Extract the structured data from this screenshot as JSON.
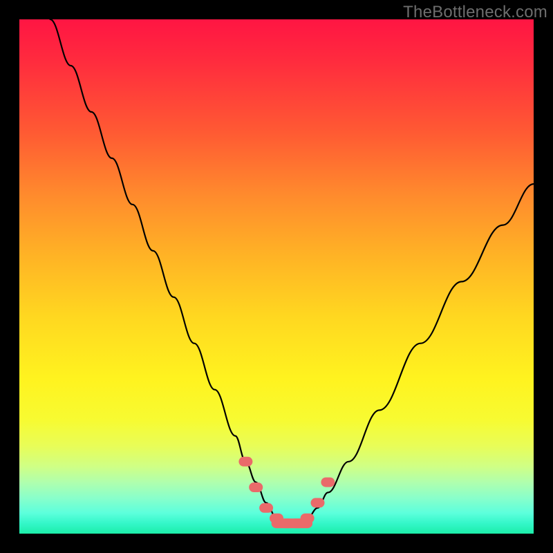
{
  "watermark": {
    "text": "TheBottleneck.com"
  },
  "chart_data": {
    "type": "line",
    "title": "",
    "xlabel": "",
    "ylabel": "",
    "xlim": [
      0,
      100
    ],
    "ylim": [
      0,
      100
    ],
    "grid": false,
    "legend": false,
    "background_gradient_meaning": "red=high bottleneck, green=low bottleneck",
    "series": [
      {
        "name": "bottleneck-curve",
        "color": "#000000",
        "x": [
          6,
          10,
          14,
          18,
          22,
          26,
          30,
          34,
          38,
          42,
          44,
          46,
          48,
          50,
          52,
          54,
          56,
          58,
          60,
          64,
          70,
          78,
          86,
          94,
          100
        ],
        "y": [
          100,
          91,
          82,
          73,
          64,
          55,
          46,
          37,
          28,
          19,
          14,
          10,
          6,
          3,
          2,
          2,
          3,
          5,
          8,
          14,
          24,
          37,
          49,
          60,
          68
        ]
      }
    ],
    "markers": {
      "name": "highlighted-points",
      "color": "#ea6a6a",
      "shape": "rounded-capsule",
      "points": [
        {
          "x": 44,
          "y": 14
        },
        {
          "x": 46,
          "y": 9
        },
        {
          "x": 48,
          "y": 5
        },
        {
          "x": 50,
          "y": 3
        },
        {
          "x": 52,
          "y": 2
        },
        {
          "x": 54,
          "y": 2
        },
        {
          "x": 56,
          "y": 3
        },
        {
          "x": 58,
          "y": 6
        },
        {
          "x": 60,
          "y": 10
        }
      ]
    }
  }
}
